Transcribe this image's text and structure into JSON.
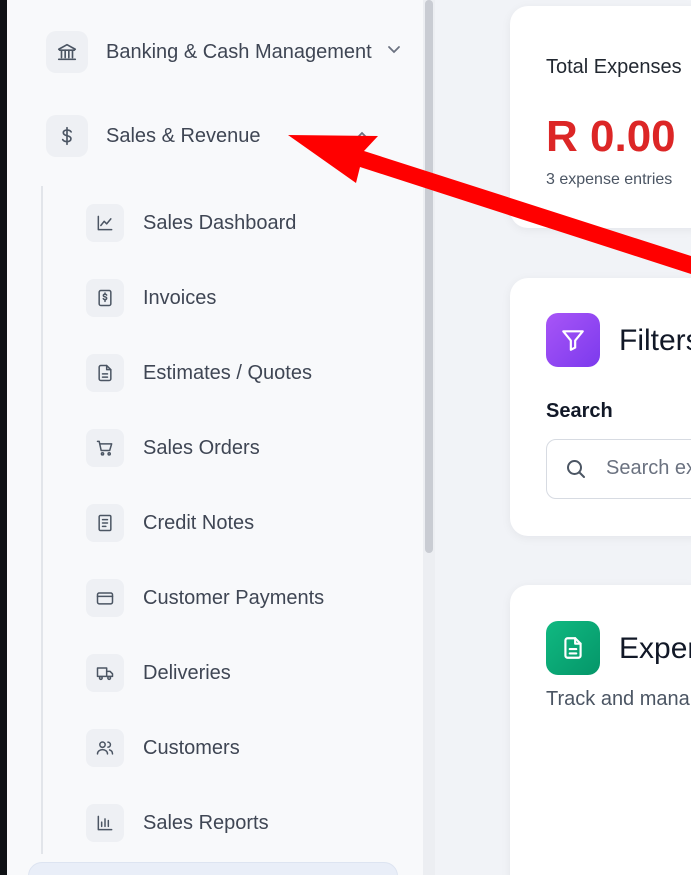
{
  "sidebar": {
    "groups": [
      {
        "label": "Banking & Cash Management",
        "icon": "bank-icon",
        "expanded": false
      },
      {
        "label": "Sales & Revenue",
        "icon": "dollar-icon",
        "expanded": true
      }
    ],
    "sales_items": [
      {
        "label": "Sales Dashboard",
        "icon": "line-chart-icon"
      },
      {
        "label": "Invoices",
        "icon": "invoice-icon"
      },
      {
        "label": "Estimates / Quotes",
        "icon": "document-icon"
      },
      {
        "label": "Sales Orders",
        "icon": "cart-icon"
      },
      {
        "label": "Credit Notes",
        "icon": "credit-note-icon"
      },
      {
        "label": "Customer Payments",
        "icon": "credit-card-icon"
      },
      {
        "label": "Deliveries",
        "icon": "truck-icon"
      },
      {
        "label": "Customers",
        "icon": "users-icon"
      },
      {
        "label": "Sales Reports",
        "icon": "bar-chart-icon"
      }
    ]
  },
  "summary": {
    "title": "Total Expenses",
    "amount": "R 0.00",
    "subtitle": "3 expense entries",
    "amount_color": "#dc2626"
  },
  "filters": {
    "title": "Filters",
    "search_label": "Search",
    "search_placeholder": "Search ex"
  },
  "expenses": {
    "title": "Exper",
    "subtitle": "Track and mana"
  },
  "colors": {
    "annotation_arrow": "#ff0000",
    "filters_icon": "#8b5cf6",
    "expenses_icon": "#10b981"
  }
}
